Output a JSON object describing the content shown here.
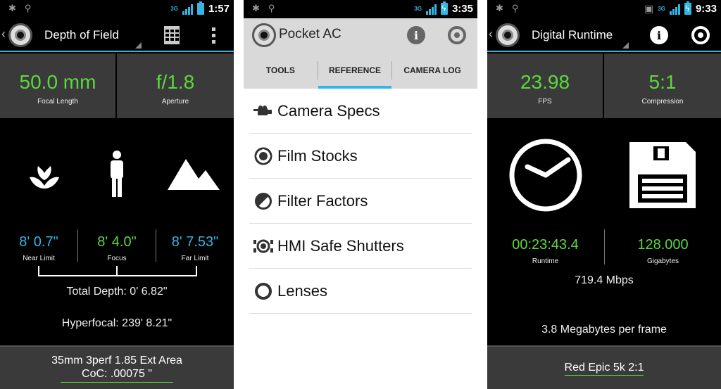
{
  "depth_of_field": {
    "status_time": "1:57",
    "network": "3G",
    "title": "Depth of Field",
    "focal_length": {
      "value": "50.0 mm",
      "label": "Focal Length"
    },
    "aperture": {
      "value": "f/1.8",
      "label": "Aperture"
    },
    "near": {
      "value": "8' 0.7\"",
      "label": "Near Limit"
    },
    "focus": {
      "value": "8' 4.0\"",
      "label": "Focus"
    },
    "far": {
      "value": "8' 7.53\"",
      "label": "Far Limit"
    },
    "total_depth": "Total Depth: 0' 6.82\"",
    "hyperfocal": "Hyperfocal: 239' 8.21\"",
    "format": "35mm 3perf 1.85 Ext Area",
    "coc": "CoC: .00075 \"",
    "icons": [
      "macro-flower-icon",
      "person-icon",
      "mountains-icon",
      "calculator-icon",
      "overflow-menu-icon"
    ],
    "colors": {
      "value_green": "#5cd83f",
      "value_blue": "#33b5e5",
      "accent": "#33b5e5"
    }
  },
  "pocket_ac": {
    "status_time": "3:35",
    "network": "3G",
    "title": "Pocket AC",
    "tabs": [
      {
        "label": "TOOLS",
        "active": false
      },
      {
        "label": "REFERENCE",
        "active": true
      },
      {
        "label": "CAMERA LOG",
        "active": false
      }
    ],
    "items": [
      {
        "label": "Camera Specs",
        "icon": "camera-icon"
      },
      {
        "label": "Film Stocks",
        "icon": "film-reel-icon"
      },
      {
        "label": "Filter Factors",
        "icon": "filter-icon"
      },
      {
        "label": "HMI Safe Shutters",
        "icon": "hmi-light-icon"
      },
      {
        "label": "Lenses",
        "icon": "lens-icon"
      }
    ]
  },
  "digital_runtime": {
    "status_time": "9:33",
    "network": "3G",
    "title": "Digital Runtime",
    "fps": {
      "value": "23.98",
      "label": "FPS"
    },
    "compression": {
      "value": "5:1",
      "label": "Compression"
    },
    "runtime": {
      "value": "00:23:43.4",
      "label": "Runtime"
    },
    "gigabytes": {
      "value": "128.000",
      "label": "Gigabytes"
    },
    "bitrate": "719.4 Mbps",
    "frame_size": "3.8 Megabytes per frame",
    "camera": "Red Epic 5k 2:1",
    "icons": [
      "clock-icon",
      "floppy-disk-icon",
      "info-icon",
      "settings-icon"
    ]
  }
}
